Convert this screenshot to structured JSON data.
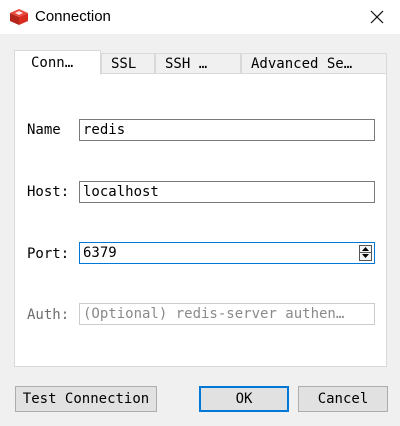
{
  "window": {
    "title": "Connection",
    "app_icon": "redis-logo-icon",
    "close_icon": "close-icon"
  },
  "tabs": [
    {
      "label": "Conn…",
      "active": true
    },
    {
      "label": "SSL",
      "active": false
    },
    {
      "label": "SSH …",
      "active": false
    },
    {
      "label": "Advanced Se…",
      "active": false
    }
  ],
  "form": {
    "name": {
      "label": "Name",
      "value": "redis"
    },
    "host": {
      "label": "Host:",
      "value": "localhost"
    },
    "port": {
      "label": "Port:",
      "value": "6379"
    },
    "auth": {
      "label": "Auth:",
      "value": "",
      "placeholder": "(Optional) redis-server authen…",
      "enabled": false
    }
  },
  "buttons": {
    "test": "Test Connection",
    "ok": "OK",
    "cancel": "Cancel"
  },
  "colors": {
    "accent": "#0078d7",
    "logo_red": "#d82c20"
  }
}
